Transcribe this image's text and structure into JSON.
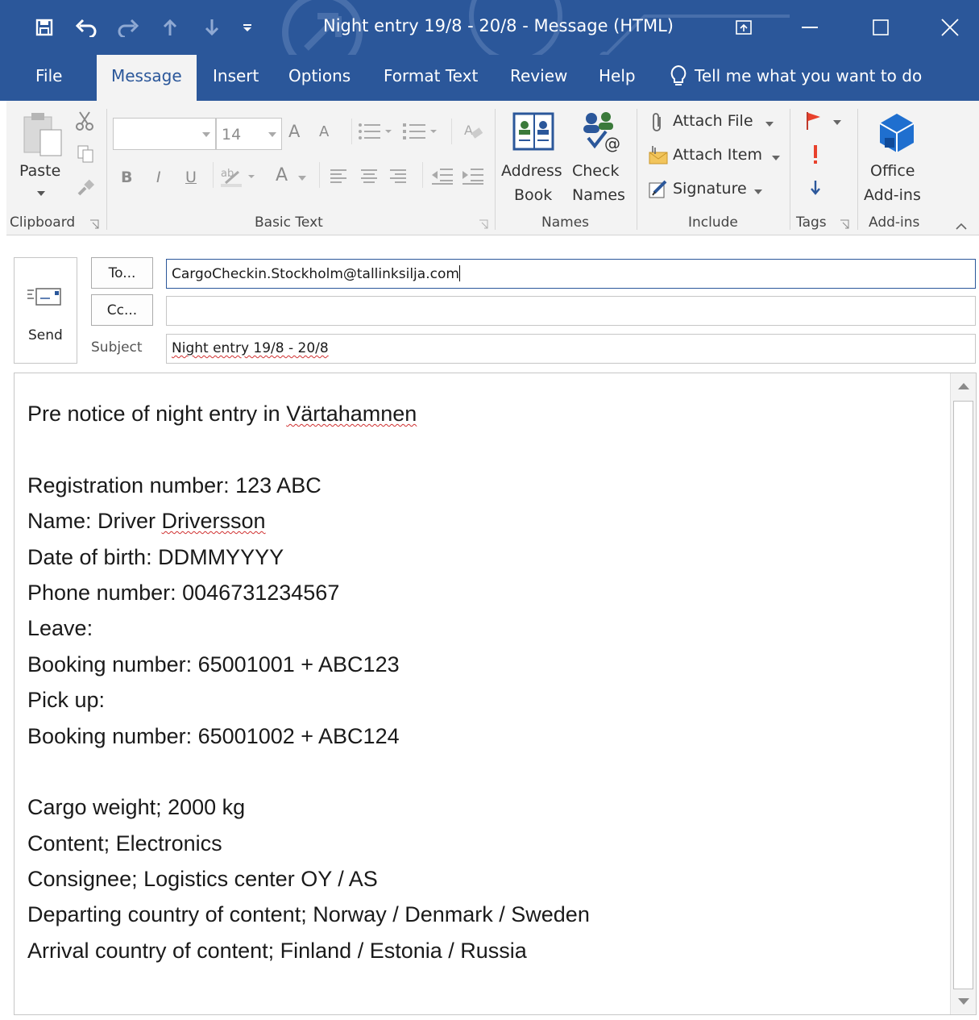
{
  "window": {
    "title": "Night entry 19/8 - 20/8  -  Message (HTML)",
    "colors": {
      "titlebar": "#2b579a",
      "ribbon": "#f3f3f3",
      "active_tab_text": "#2b579a"
    }
  },
  "tabs": [
    {
      "label": "File"
    },
    {
      "label": "Message",
      "active": true
    },
    {
      "label": "Insert"
    },
    {
      "label": "Options"
    },
    {
      "label": "Format Text"
    },
    {
      "label": "Review"
    },
    {
      "label": "Help"
    }
  ],
  "tell_me": "Tell me what you want to do",
  "ribbon": {
    "clipboard": {
      "label": "Clipboard",
      "paste": "Paste"
    },
    "basic_text": {
      "label": "Basic Text",
      "font_size": "14",
      "bold": "B",
      "italic": "I",
      "underline": "U",
      "font_color": "A",
      "grow": "A",
      "shrink": "A"
    },
    "names": {
      "label": "Names",
      "address_book": [
        "Address",
        "Book"
      ],
      "check_names": [
        "Check",
        "Names"
      ]
    },
    "include": {
      "label": "Include",
      "attach_file": "Attach File",
      "attach_item": "Attach Item",
      "signature": "Signature"
    },
    "tags": {
      "label": "Tags"
    },
    "addins": {
      "label": "Add-ins",
      "office_addins": [
        "Office",
        "Add-ins"
      ]
    }
  },
  "compose": {
    "send": "Send",
    "to_button": "To...",
    "cc_button": "Cc...",
    "subject_label": "Subject",
    "to_value": "CargoCheckin.Stockholm@tallinksilja.com",
    "cc_value": "",
    "subject_value": "Night entry 19/8 - 20/8"
  },
  "body": {
    "lines": [
      "Pre notice of night entry in Värtahamnen",
      "",
      "Registration number: 123 ABC",
      "Name: Driver Driversson",
      "Date of birth: DDMMYYYY",
      "Phone number: 0046731234567",
      "Leave:",
      "Booking number: 65001001 + ABC123",
      "Pick up:",
      "Booking number: 65001002 + ABC124",
      "",
      "Cargo weight; 2000 kg",
      "Content; Electronics",
      "Consignee; Logistics center OY / AS",
      "Departing country of content; Norway / Denmark / Sweden",
      "Arrival country of content; Finland / Estonia / Russia"
    ]
  }
}
